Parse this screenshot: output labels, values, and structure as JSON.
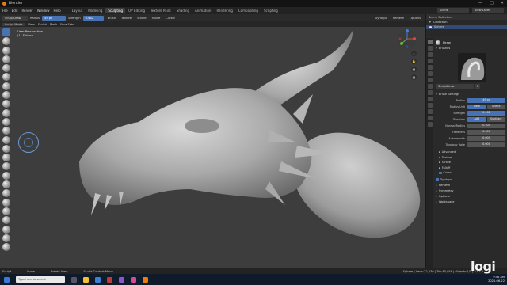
{
  "window": {
    "title": "Blender",
    "controls": [
      "—",
      "□",
      "✕"
    ]
  },
  "menu": {
    "items": [
      "File",
      "Edit",
      "Render",
      "Window",
      "Help"
    ],
    "workspaces": [
      "Layout",
      "Modeling",
      "Sculpting",
      "UV Editing",
      "Texture Paint",
      "Shading",
      "Animation",
      "Rendering",
      "Compositing",
      "Scripting"
    ],
    "active_workspace": "Sculpting",
    "scene": "Scene",
    "view_layer": "View Layer"
  },
  "tool_header": {
    "brush_name": "SculptDraw",
    "radius_label": "Radius",
    "radius_value": "49 px",
    "strength_label": "Strength",
    "strength_value": "0.462",
    "dropdowns": [
      "Brush",
      "Texture",
      "Stroke",
      "Falloff",
      "Cursor"
    ],
    "right": [
      "Dyntopo",
      "Remesh",
      "Options"
    ]
  },
  "viewport_header": {
    "mode": "Sculpt Mode",
    "menus": [
      "View",
      "Sculpt",
      "Mask",
      "Face Sets"
    ]
  },
  "viewport": {
    "overlay_line1": "User Perspective",
    "overlay_line2": "(1) Sphere"
  },
  "outliner": {
    "title": "Scene Collection",
    "items": [
      "Collection",
      "Sphere"
    ]
  },
  "properties": {
    "tool_name": "Draw",
    "brushes_panel": "Brushes",
    "brush_name": "SculptDraw",
    "brush_users": "2",
    "brush_settings_panel": "Brush Settings",
    "rows": [
      {
        "label": "Radius",
        "value": "49 px",
        "style": "blu"
      },
      {
        "label": "Radius Unit",
        "value_a": "View",
        "value_b": "Scene"
      },
      {
        "label": "Strength",
        "value": "0.462",
        "style": "blu"
      },
      {
        "label": "Direction",
        "value_a": "Add",
        "value_b": "Subtract"
      },
      {
        "label": "Normal Radius",
        "value": "0.500"
      },
      {
        "label": "Hardness",
        "value": "0.000"
      },
      {
        "label": "Autosmooth",
        "value": "0.000"
      },
      {
        "label": "Topology Rake",
        "value": "0.000"
      }
    ],
    "subpanels": [
      "Advanced",
      "Texture",
      "Stroke",
      "Falloff",
      "Cursor"
    ],
    "sections": [
      "Dyntopo",
      "Remesh",
      "Symmetry",
      "Options",
      "Workspace"
    ]
  },
  "statusbar": {
    "left": [
      "Sculpt",
      "Move",
      "Rotate View",
      "Sculpt Context Menu"
    ],
    "right": "Sphere | Verts:22,530 | Tris:45,056 | Objects:1/1 | 2.92.0"
  },
  "taskbar": {
    "search_placeholder": "Type here to search",
    "time": "9:58 AM",
    "date": "2021-06-22"
  },
  "watermark": "logi",
  "colors": {
    "accent": "#4772b3",
    "viewport": "#3d3d3d",
    "header": "#2b2b2b",
    "blender_orange": "#e87d0d"
  }
}
